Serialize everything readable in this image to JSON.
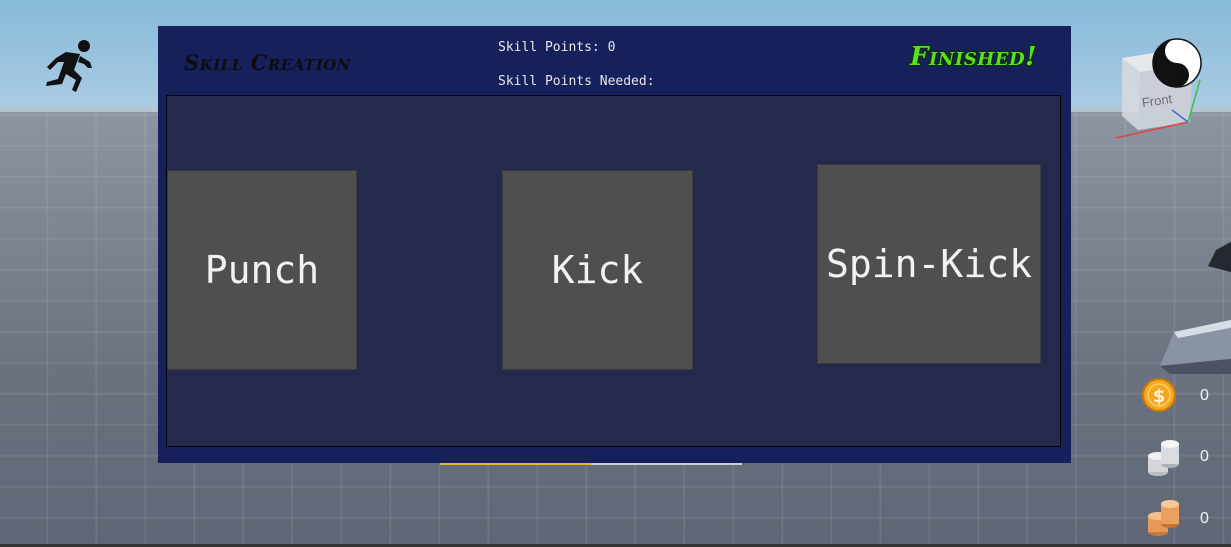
{
  "panel": {
    "title": "Skill Creation",
    "skill_points_label": "Skill Points: 0",
    "skill_points_needed_label": "Skill Points Needed:",
    "finished_label": "Finished!"
  },
  "skills": [
    {
      "label": "Punch"
    },
    {
      "label": "Kick"
    },
    {
      "label": "Spin-Kick"
    }
  ],
  "progress": {
    "fraction": 0.5,
    "fill_color": "#e0b82a"
  },
  "view_cube": {
    "face_label": "Front"
  },
  "currencies": [
    {
      "icon": "gold-coin-icon",
      "amount": "0"
    },
    {
      "icon": "silver-coins-icon",
      "amount": "0"
    },
    {
      "icon": "copper-coins-icon",
      "amount": "0"
    }
  ],
  "colors": {
    "panel_bg": "#16205a",
    "inner_bg": "#252a4d",
    "skill_tile": "#4f4f4f",
    "finished_green": "#58e21a"
  }
}
